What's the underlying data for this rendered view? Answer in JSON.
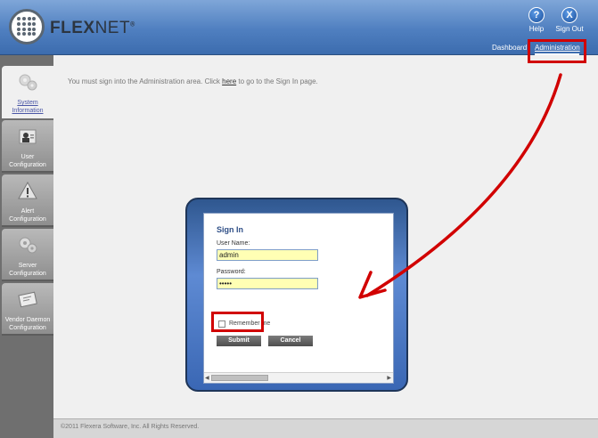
{
  "header": {
    "brand_bold": "FLEX",
    "brand_thin": "NET",
    "brand_mark": "®",
    "help_label": "Help",
    "signout_label": "Sign Out",
    "nav": [
      {
        "label": "Dashboard"
      },
      {
        "label": "Administration",
        "active": true
      }
    ]
  },
  "sidebar": {
    "items": [
      {
        "label_1": "System",
        "label_2": "Information",
        "active": true,
        "icon": "gears-icon"
      },
      {
        "label_1": "User",
        "label_2": "Configuration",
        "icon": "user-card-icon"
      },
      {
        "label_1": "Alert",
        "label_2": "Configuration",
        "icon": "warning-icon"
      },
      {
        "label_1": "Server",
        "label_2": "Configuration",
        "icon": "gears-icon"
      },
      {
        "label_1": "Vendor Daemon",
        "label_2": "Configuration",
        "icon": "certificate-icon"
      }
    ]
  },
  "main": {
    "message_before": "You must sign into the Administration area. Click ",
    "message_link": "here",
    "message_after": " to go to the Sign In page."
  },
  "signin": {
    "title": "Sign In",
    "username_label": "User Name:",
    "username_value": "admin",
    "password_label": "Password:",
    "password_value": "•••••",
    "remember_label": "Remember me",
    "submit_label": "Submit",
    "cancel_label": "Cancel"
  },
  "footer": {
    "copyright": "©2011 Flexera Software, Inc. All Rights Reserved."
  },
  "annotation_color": "#d10000"
}
